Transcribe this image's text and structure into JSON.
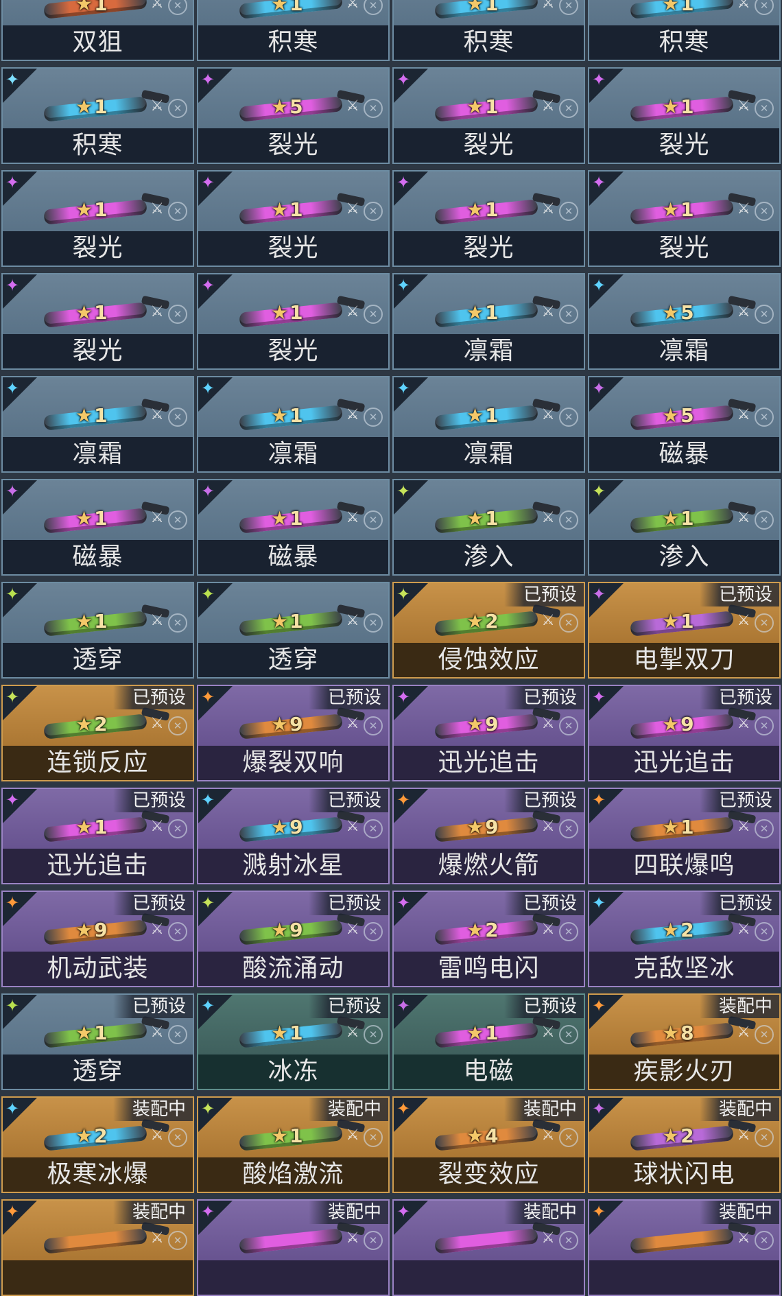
{
  "cards": [
    {
      "name": "双狙",
      "stars": "1",
      "tag": "",
      "rarity": "blue",
      "element_icon": "",
      "element_color": "#7ee0ff",
      "weapon_color": "#d86a3e"
    },
    {
      "name": "积寒",
      "stars": "1",
      "tag": "",
      "rarity": "blue",
      "element_icon": "",
      "element_color": "#7ee0ff",
      "weapon_color": "#4fc4ee"
    },
    {
      "name": "积寒",
      "stars": "1",
      "tag": "",
      "rarity": "blue",
      "element_icon": "",
      "element_color": "#7ee0ff",
      "weapon_color": "#4fc4ee"
    },
    {
      "name": "积寒",
      "stars": "1",
      "tag": "",
      "rarity": "blue",
      "element_icon": "",
      "element_color": "#7ee0ff",
      "weapon_color": "#4fc4ee"
    },
    {
      "name": "积寒",
      "stars": "1",
      "tag": "",
      "rarity": "blue",
      "element_icon": "frost-icon",
      "element_color": "#7ee0ff",
      "weapon_color": "#4fc4ee"
    },
    {
      "name": "裂光",
      "stars": "5",
      "tag": "",
      "rarity": "blue",
      "element_icon": "split-light-icon",
      "element_color": "#d46df0",
      "weapon_color": "#e05ee0"
    },
    {
      "name": "裂光",
      "stars": "1",
      "tag": "",
      "rarity": "blue",
      "element_icon": "split-light-icon",
      "element_color": "#d46df0",
      "weapon_color": "#e05ee0"
    },
    {
      "name": "裂光",
      "stars": "1",
      "tag": "",
      "rarity": "blue",
      "element_icon": "split-light-icon",
      "element_color": "#d46df0",
      "weapon_color": "#e05ee0"
    },
    {
      "name": "裂光",
      "stars": "1",
      "tag": "",
      "rarity": "blue",
      "element_icon": "split-light-icon",
      "element_color": "#d46df0",
      "weapon_color": "#e05ee0"
    },
    {
      "name": "裂光",
      "stars": "1",
      "tag": "",
      "rarity": "blue",
      "element_icon": "split-light-icon",
      "element_color": "#d46df0",
      "weapon_color": "#e05ee0"
    },
    {
      "name": "裂光",
      "stars": "1",
      "tag": "",
      "rarity": "blue",
      "element_icon": "split-light-icon",
      "element_color": "#d46df0",
      "weapon_color": "#e05ee0"
    },
    {
      "name": "裂光",
      "stars": "1",
      "tag": "",
      "rarity": "blue",
      "element_icon": "split-light-icon",
      "element_color": "#d46df0",
      "weapon_color": "#e05ee0"
    },
    {
      "name": "裂光",
      "stars": "1",
      "tag": "",
      "rarity": "blue",
      "element_icon": "split-light-icon",
      "element_color": "#d46df0",
      "weapon_color": "#e05ee0"
    },
    {
      "name": "裂光",
      "stars": "1",
      "tag": "",
      "rarity": "blue",
      "element_icon": "split-light-icon",
      "element_color": "#d46df0",
      "weapon_color": "#e05ee0"
    },
    {
      "name": "凛霜",
      "stars": "1",
      "tag": "",
      "rarity": "blue",
      "element_icon": "ice-crystal-icon",
      "element_color": "#5fd3ff",
      "weapon_color": "#4fc4ee"
    },
    {
      "name": "凛霜",
      "stars": "5",
      "tag": "",
      "rarity": "blue",
      "element_icon": "ice-crystal-icon",
      "element_color": "#5fd3ff",
      "weapon_color": "#4fc4ee"
    },
    {
      "name": "凛霜",
      "stars": "1",
      "tag": "",
      "rarity": "blue",
      "element_icon": "ice-crystal-icon",
      "element_color": "#5fd3ff",
      "weapon_color": "#4fc4ee"
    },
    {
      "name": "凛霜",
      "stars": "1",
      "tag": "",
      "rarity": "blue",
      "element_icon": "ice-crystal-icon",
      "element_color": "#5fd3ff",
      "weapon_color": "#4fc4ee"
    },
    {
      "name": "凛霜",
      "stars": "1",
      "tag": "",
      "rarity": "blue",
      "element_icon": "ice-crystal-icon",
      "element_color": "#5fd3ff",
      "weapon_color": "#4fc4ee"
    },
    {
      "name": "磁暴",
      "stars": "5",
      "tag": "",
      "rarity": "blue",
      "element_icon": "magnetic-burst-icon",
      "element_color": "#c86ee8",
      "weapon_color": "#e05ee0"
    },
    {
      "name": "磁暴",
      "stars": "1",
      "tag": "",
      "rarity": "blue",
      "element_icon": "magnetic-burst-icon",
      "element_color": "#c86ee8",
      "weapon_color": "#e05ee0"
    },
    {
      "name": "磁暴",
      "stars": "1",
      "tag": "",
      "rarity": "blue",
      "element_icon": "magnetic-burst-icon",
      "element_color": "#c86ee8",
      "weapon_color": "#e05ee0"
    },
    {
      "name": "渗入",
      "stars": "1",
      "tag": "",
      "rarity": "blue",
      "element_icon": "infiltrate-icon",
      "element_color": "#c6e35a",
      "weapon_color": "#7fc24a"
    },
    {
      "name": "渗入",
      "stars": "1",
      "tag": "",
      "rarity": "blue",
      "element_icon": "infiltrate-icon",
      "element_color": "#c6e35a",
      "weapon_color": "#7fc24a"
    },
    {
      "name": "透穿",
      "stars": "1",
      "tag": "",
      "rarity": "blue",
      "element_icon": "pierce-icon",
      "element_color": "#b9e04f",
      "weapon_color": "#7fc24a"
    },
    {
      "name": "透穿",
      "stars": "1",
      "tag": "",
      "rarity": "blue",
      "element_icon": "pierce-icon",
      "element_color": "#b9e04f",
      "weapon_color": "#7fc24a"
    },
    {
      "name": "侵蚀效应",
      "stars": "2",
      "tag": "已预设",
      "rarity": "gold",
      "element_icon": "erosion-icon",
      "element_color": "#c6e35a",
      "weapon_color": "#7fc24a"
    },
    {
      "name": "电掣双刀",
      "stars": "1",
      "tag": "已预设",
      "rarity": "gold",
      "element_icon": "twin-blades-icon",
      "element_color": "#c86ee8",
      "weapon_color": "#b86ad8"
    },
    {
      "name": "连锁反应",
      "stars": "2",
      "tag": "已预设",
      "rarity": "gold",
      "element_icon": "chain-reaction-icon",
      "element_color": "#c6e35a",
      "weapon_color": "#7fc24a"
    },
    {
      "name": "爆裂双响",
      "stars": "9",
      "tag": "已预设",
      "rarity": "purple",
      "element_icon": "burst-icon",
      "element_color": "#ff9a3a",
      "weapon_color": "#e08a3e"
    },
    {
      "name": "迅光追击",
      "stars": "9",
      "tag": "已预设",
      "rarity": "purple",
      "element_icon": "swift-light-icon",
      "element_color": "#d46df0",
      "weapon_color": "#e05ee0"
    },
    {
      "name": "迅光追击",
      "stars": "9",
      "tag": "已预设",
      "rarity": "purple",
      "element_icon": "swift-light-icon",
      "element_color": "#d46df0",
      "weapon_color": "#e05ee0"
    },
    {
      "name": "迅光追击",
      "stars": "1",
      "tag": "已预设",
      "rarity": "purple",
      "element_icon": "swift-light-icon",
      "element_color": "#d46df0",
      "weapon_color": "#e05ee0"
    },
    {
      "name": "溅射冰星",
      "stars": "9",
      "tag": "已预设",
      "rarity": "purple",
      "element_icon": "ice-star-icon",
      "element_color": "#5fd3ff",
      "weapon_color": "#4fc4ee"
    },
    {
      "name": "爆燃火箭",
      "stars": "9",
      "tag": "已预设",
      "rarity": "purple",
      "element_icon": "rocket-icon",
      "element_color": "#ff9a3a",
      "weapon_color": "#e08a3e"
    },
    {
      "name": "四联爆鸣",
      "stars": "1",
      "tag": "已预设",
      "rarity": "purple",
      "element_icon": "quad-blast-icon",
      "element_color": "#ff9a3a",
      "weapon_color": "#e08a3e"
    },
    {
      "name": "机动武装",
      "stars": "9",
      "tag": "已预设",
      "rarity": "purple",
      "element_icon": "mobile-arms-icon",
      "element_color": "#ff9a3a",
      "weapon_color": "#e08a3e"
    },
    {
      "name": "酸流涌动",
      "stars": "9",
      "tag": "已预设",
      "rarity": "purple",
      "element_icon": "acid-flow-icon",
      "element_color": "#c6e35a",
      "weapon_color": "#7fc24a"
    },
    {
      "name": "雷鸣电闪",
      "stars": "2",
      "tag": "已预设",
      "rarity": "purple",
      "element_icon": "thunder-icon",
      "element_color": "#d46df0",
      "weapon_color": "#e05ee0"
    },
    {
      "name": "克敌坚冰",
      "stars": "2",
      "tag": "已预设",
      "rarity": "purple",
      "element_icon": "hard-ice-icon",
      "element_color": "#5fd3ff",
      "weapon_color": "#4fc4ee"
    },
    {
      "name": "透穿",
      "stars": "1",
      "tag": "已预设",
      "rarity": "blue",
      "element_icon": "pierce-icon",
      "element_color": "#b9e04f",
      "weapon_color": "#7fc24a"
    },
    {
      "name": "冰冻",
      "stars": "1",
      "tag": "已预设",
      "rarity": "teal",
      "element_icon": "snowflake-icon",
      "element_color": "#5fd3ff",
      "weapon_color": "#4fc4ee"
    },
    {
      "name": "电磁",
      "stars": "1",
      "tag": "已预设",
      "rarity": "teal",
      "element_icon": "lightning-icon",
      "element_color": "#c86ee8",
      "weapon_color": "#e05ee0"
    },
    {
      "name": "疾影火刃",
      "stars": "8",
      "tag": "装配中",
      "rarity": "gold",
      "element_icon": "flame-blade-icon",
      "element_color": "#ff9a3a",
      "weapon_color": "#e08a3e"
    },
    {
      "name": "极寒冰爆",
      "stars": "2",
      "tag": "装配中",
      "rarity": "gold",
      "element_icon": "frost-icon",
      "element_color": "#5fd3ff",
      "weapon_color": "#4fc4ee"
    },
    {
      "name": "酸焰激流",
      "stars": "1",
      "tag": "装配中",
      "rarity": "gold",
      "element_icon": "acid-flame-icon",
      "element_color": "#c6e35a",
      "weapon_color": "#7fc24a"
    },
    {
      "name": "裂变效应",
      "stars": "4",
      "tag": "装配中",
      "rarity": "gold",
      "element_icon": "fission-icon",
      "element_color": "#ff9a3a",
      "weapon_color": "#e08a3e"
    },
    {
      "name": "球状闪电",
      "stars": "2",
      "tag": "装配中",
      "rarity": "gold",
      "element_icon": "ball-lightning-icon",
      "element_color": "#c86ee8",
      "weapon_color": "#b86ad8"
    },
    {
      "name": "",
      "stars": "",
      "tag": "装配中",
      "rarity": "gold",
      "element_icon": "flame-icon",
      "element_color": "#ff9a3a",
      "weapon_color": "#e08a3e"
    },
    {
      "name": "",
      "stars": "",
      "tag": "装配中",
      "rarity": "purple",
      "element_icon": "cluster-icon",
      "element_color": "#d46df0",
      "weapon_color": "#e05ee0"
    },
    {
      "name": "",
      "stars": "",
      "tag": "装配中",
      "rarity": "purple",
      "element_icon": "thunder-icon",
      "element_color": "#d46df0",
      "weapon_color": "#e05ee0"
    },
    {
      "name": "",
      "stars": "",
      "tag": "装配中",
      "rarity": "purple",
      "element_icon": "flame-icon",
      "element_color": "#ff9a3a",
      "weapon_color": "#e08a3e"
    }
  ]
}
